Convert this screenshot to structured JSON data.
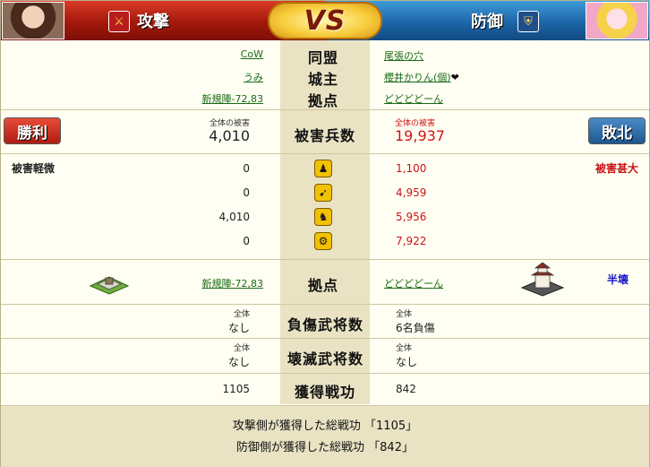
{
  "header": {
    "attacker_label": "攻撃",
    "defender_label": "防御",
    "vs": "VS",
    "attacker_icon": "crossed-swords-icon",
    "defender_icon": "shield-icon"
  },
  "rows": {
    "alliance": {
      "attacker": "CoW",
      "label": "同盟",
      "defender": "尾張の穴"
    },
    "lord": {
      "attacker": "うみ",
      "label": "城主",
      "defender": "櫻井かりん(個)",
      "defender_icon": "heart-icon"
    },
    "base": {
      "attacker": "新規陣-72,83",
      "label": "拠点",
      "defender": "どどどどーん"
    }
  },
  "damage": {
    "result_attacker": "勝利",
    "result_defender": "敗北",
    "label": "被害兵数",
    "attacker_caption": "全体の被害",
    "attacker_total": "4,010",
    "defender_caption": "全体の被害",
    "defender_total": "19,937"
  },
  "units": {
    "attacker_status": "被害軽微",
    "defender_status": "被害甚大",
    "rows": [
      {
        "icon": "infantry-icon",
        "attacker": "0",
        "defender": "1,100"
      },
      {
        "icon": "bow-icon",
        "attacker": "0",
        "defender": "4,959"
      },
      {
        "icon": "cavalry-icon",
        "attacker": "4,010",
        "defender": "5,956"
      },
      {
        "icon": "siege-icon",
        "attacker": "0",
        "defender": "7,922"
      }
    ]
  },
  "base_row": {
    "attacker": "新規陣-72,83",
    "label": "拠点",
    "defender": "どどどどーん",
    "defender_status": "半壊",
    "attacker_icon": "camp-building-icon",
    "defender_icon": "castle-building-icon"
  },
  "injured": {
    "label": "負傷武将数",
    "attacker_caption": "全体",
    "attacker_value": "なし",
    "defender_caption": "全体",
    "defender_value": "6名負傷"
  },
  "destroyed": {
    "label": "壊滅武将数",
    "attacker_caption": "全体",
    "attacker_value": "なし",
    "defender_caption": "全体",
    "defender_value": "なし"
  },
  "merit": {
    "label": "獲得戦功",
    "attacker": "1105",
    "defender": "842"
  },
  "footer": {
    "line1": "攻撃側が獲得した総戦功 「1105」",
    "line2": "防御側が獲得した総戦功 「842」"
  },
  "colors": {
    "attacker_red": "#a3190c",
    "defender_blue": "#1d66a8",
    "center_band": "#e9e3c4",
    "link_green": "#1a6b16",
    "damage_red": "#c81414"
  }
}
